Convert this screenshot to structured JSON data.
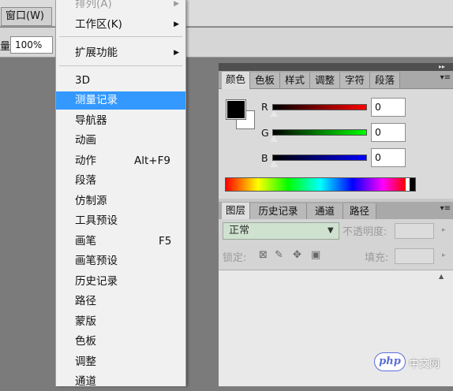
{
  "menubar": {
    "window_menu": "窗口(W)"
  },
  "options_bar": {
    "opacity_label": "量:",
    "opacity_value": "100%"
  },
  "window_menu": {
    "items": [
      {
        "label": "排列(A)",
        "submenu": true,
        "state": "disabled"
      },
      {
        "label": "工作区(K)",
        "submenu": true
      },
      {
        "label": "扩展功能",
        "submenu": true
      },
      {
        "label": "3D"
      },
      {
        "label": "测量记录",
        "state": "selected"
      },
      {
        "label": "导航器"
      },
      {
        "label": "动画"
      },
      {
        "label": "动作",
        "shortcut": "Alt+F9"
      },
      {
        "label": "段落"
      },
      {
        "label": "仿制源"
      },
      {
        "label": "工具预设"
      },
      {
        "label": "画笔",
        "shortcut": "F5"
      },
      {
        "label": "画笔预设"
      },
      {
        "label": "历史记录"
      },
      {
        "label": "路径"
      },
      {
        "label": "蒙版"
      },
      {
        "label": "色板"
      },
      {
        "label": "调整"
      },
      {
        "label": "通道"
      }
    ]
  },
  "color_panel": {
    "tabs": [
      "颜色",
      "色板",
      "样式",
      "调整",
      "字符",
      "段落"
    ],
    "active_tab": "颜色",
    "channels": [
      {
        "letter": "R",
        "value": "0",
        "color": "#ff0000"
      },
      {
        "letter": "G",
        "value": "0",
        "color": "#00ff00"
      },
      {
        "letter": "B",
        "value": "0",
        "color": "#0000ff"
      }
    ],
    "foreground": "#000000",
    "background": "#ffffff"
  },
  "layers_panel": {
    "tabs": [
      "图层",
      "历史记录",
      "通道",
      "路径"
    ],
    "active_tab": "图层",
    "blend_mode": "正常",
    "opacity_label": "不透明度:",
    "lock_label": "锁定:",
    "fill_label": "填充:"
  },
  "watermark": {
    "logo": "php",
    "text": "中文网"
  }
}
